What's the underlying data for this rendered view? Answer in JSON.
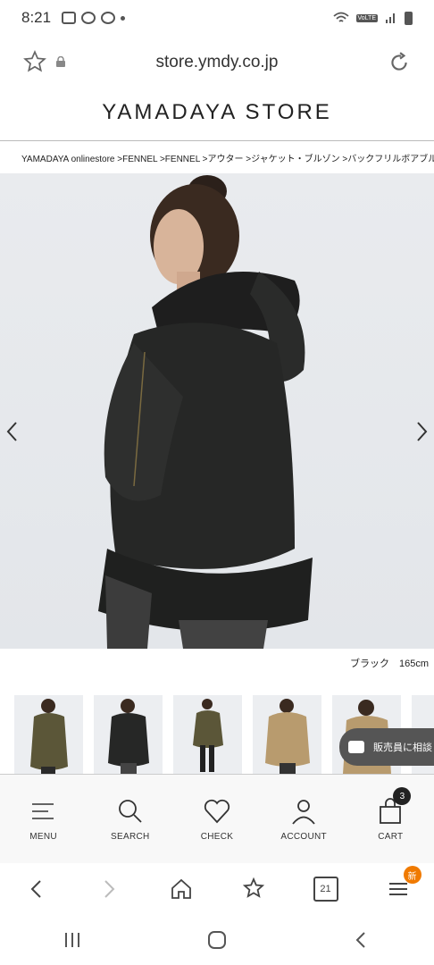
{
  "status_bar": {
    "time": "8:21",
    "icons": [
      "image-icon",
      "app-icon",
      "line-icon",
      "dot-icon"
    ],
    "right_text": "VoLTE"
  },
  "browser": {
    "url": "store.ymdy.co.jp"
  },
  "site": {
    "logo": "YAMADAYA STORE",
    "breadcrumb": "YAMADAYA onlinestore >FENNEL >FENNEL >アウター >ジャケット・ブルゾン >バックフリルボアブルゾン",
    "image_caption": "ブラック　165cm",
    "consult_label": "販売員に相談"
  },
  "site_nav": [
    {
      "label": "MENU",
      "icon": "menu-icon"
    },
    {
      "label": "SEARCH",
      "icon": "search-icon"
    },
    {
      "label": "CHECK",
      "icon": "heart-icon"
    },
    {
      "label": "ACCOUNT",
      "icon": "account-icon"
    },
    {
      "label": "CART",
      "icon": "cart-icon",
      "badge": "3"
    }
  ],
  "browser_bar": {
    "tab_count": "21",
    "new_badge": "新"
  },
  "colors": {
    "jacket_black": "#2a2b2a",
    "jacket_olive": "#5b5638",
    "jacket_beige": "#b89b6e",
    "consult_bg": "#555555",
    "new_badge": "#f07a00"
  }
}
